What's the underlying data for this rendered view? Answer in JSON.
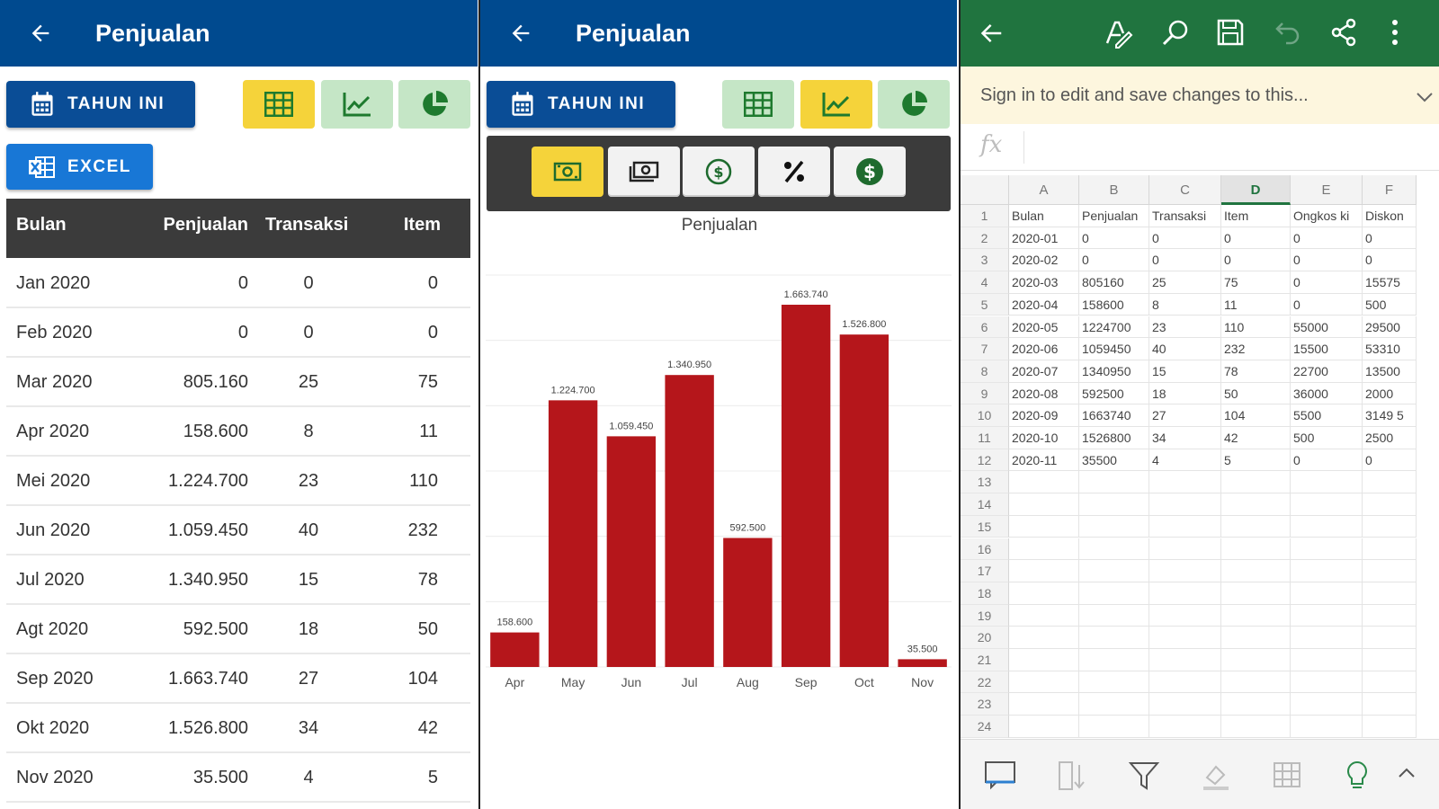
{
  "left": {
    "title": "Penjualan",
    "period_button": "TAHUN INI",
    "excel_button": "EXCEL",
    "table": {
      "headers": {
        "bulan": "Bulan",
        "penjualan": "Penjualan",
        "transaksi": "Transaksi",
        "item": "Item"
      },
      "rows": [
        {
          "bulan": "Jan 2020",
          "penjualan": "0",
          "transaksi": "0",
          "item": "0"
        },
        {
          "bulan": "Feb 2020",
          "penjualan": "0",
          "transaksi": "0",
          "item": "0"
        },
        {
          "bulan": "Mar 2020",
          "penjualan": "805.160",
          "transaksi": "25",
          "item": "75"
        },
        {
          "bulan": "Apr 2020",
          "penjualan": "158.600",
          "transaksi": "8",
          "item": "11"
        },
        {
          "bulan": "Mei 2020",
          "penjualan": "1.224.700",
          "transaksi": "23",
          "item": "110"
        },
        {
          "bulan": "Jun 2020",
          "penjualan": "1.059.450",
          "transaksi": "40",
          "item": "232"
        },
        {
          "bulan": "Jul 2020",
          "penjualan": "1.340.950",
          "transaksi": "15",
          "item": "78"
        },
        {
          "bulan": "Agt 2020",
          "penjualan": "592.500",
          "transaksi": "18",
          "item": "50"
        },
        {
          "bulan": "Sep 2020",
          "penjualan": "1.663.740",
          "transaksi": "27",
          "item": "104"
        },
        {
          "bulan": "Okt 2020",
          "penjualan": "1.526.800",
          "transaksi": "34",
          "item": "42"
        },
        {
          "bulan": "Nov 2020",
          "penjualan": "35.500",
          "transaksi": "4",
          "item": "5"
        }
      ]
    }
  },
  "middle": {
    "title": "Penjualan",
    "period_button": "TAHUN INI",
    "chart_data": {
      "type": "bar",
      "title": "Penjualan",
      "categories": [
        "Apr",
        "May",
        "Jun",
        "Jul",
        "Aug",
        "Sep",
        "Oct",
        "Nov"
      ],
      "values": [
        158600,
        1224700,
        1059450,
        1340950,
        592500,
        1663740,
        1526800,
        35500
      ],
      "value_labels": [
        "158.600",
        "1.224.700",
        "1.059.450",
        "1.340.950",
        "592.500",
        "1.663.740",
        "1.526.800",
        "35.500"
      ],
      "ylim": [
        0,
        1800000
      ],
      "bar_color": "#b5161b",
      "grid": true
    }
  },
  "right": {
    "notice": "Sign in to edit and save changes to this...",
    "formula_label": "fx",
    "columns": [
      "A",
      "B",
      "C",
      "D",
      "E",
      "F"
    ],
    "selected_column": "D",
    "row_numbers": [
      "1",
      "2",
      "3",
      "4",
      "5",
      "6",
      "7",
      "8",
      "9",
      "10",
      "11",
      "12",
      "13",
      "14",
      "15",
      "16",
      "17",
      "18",
      "19",
      "20",
      "21",
      "22",
      "23",
      "24"
    ],
    "rows": [
      [
        "Bulan",
        "Penjualan",
        "Transaksi",
        "Item",
        "Ongkos ki",
        "Diskon"
      ],
      [
        "2020-01",
        "0",
        "0",
        "0",
        "0",
        "0"
      ],
      [
        "2020-02",
        "0",
        "0",
        "0",
        "0",
        "0"
      ],
      [
        "2020-03",
        "805160",
        "25",
        "75",
        "0",
        "15575"
      ],
      [
        "2020-04",
        "158600",
        "8",
        "11",
        "0",
        "500"
      ],
      [
        "2020-05",
        "1224700",
        "23",
        "110",
        "55000",
        "29500"
      ],
      [
        "2020-06",
        "1059450",
        "40",
        "232",
        "15500",
        "53310"
      ],
      [
        "2020-07",
        "1340950",
        "15",
        "78",
        "22700",
        "13500"
      ],
      [
        "2020-08",
        "592500",
        "18",
        "50",
        "36000",
        "2000"
      ],
      [
        "2020-09",
        "1663740",
        "27",
        "104",
        "5500",
        "3149 5"
      ],
      [
        "2020-10",
        "1526800",
        "34",
        "42",
        "500",
        "2500"
      ],
      [
        "2020-11",
        "35500",
        "4",
        "5",
        "0",
        "0"
      ]
    ]
  },
  "colors": {
    "appbar": "#004a8f",
    "active_toggle": "#f5d33a",
    "inactive_toggle": "#c5e6c6",
    "excel_green": "#20743f"
  }
}
